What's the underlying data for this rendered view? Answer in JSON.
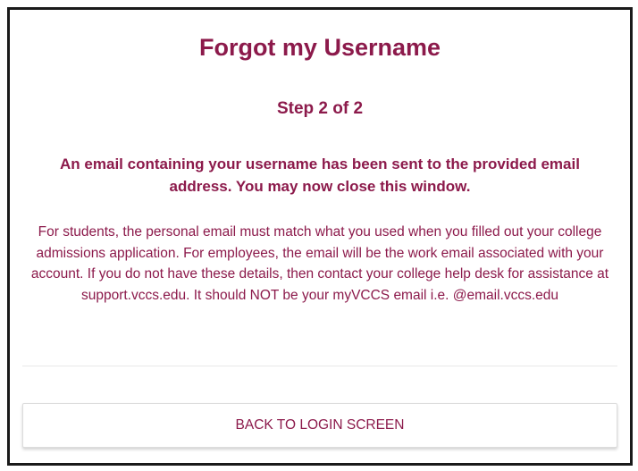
{
  "page": {
    "title": "Forgot my Username",
    "step": "Step 2 of 2",
    "confirmation": "An email containing your username has been sent to the provided email address. You may now close this window.",
    "info": "For students, the personal email must match what you used when you filled out your college admissions application. For employees, the email will be the work email associated with your account. If you do not have these details, then contact your college help desk for assistance at support.vccs.edu. It should NOT be your myVCCS email i.e. @email.vccs.edu"
  },
  "actions": {
    "back_label": "BACK TO LOGIN SCREEN"
  },
  "colors": {
    "accent": "#8c1a4b",
    "border": "#1a1a1a",
    "divider": "#e8e8e8"
  }
}
